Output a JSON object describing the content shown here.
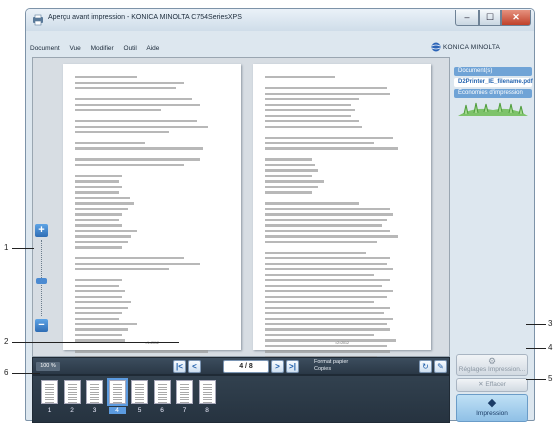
{
  "window": {
    "title": "Aperçu avant impression - KONICA MINOLTA C754SeriesXPS",
    "min": "–",
    "max": "☐",
    "close": "✕"
  },
  "menu": [
    {
      "label": "Document"
    },
    {
      "label": "Vue"
    },
    {
      "label": "Modifier"
    },
    {
      "label": "Outil"
    },
    {
      "label": "Aide"
    }
  ],
  "brand": {
    "name": "KONICA MINOLTA"
  },
  "side_panel": {
    "documents_label": "Document(s)",
    "file_name": "D2Printer_IE_filename.pdf",
    "eco_label": "Économies d'impression"
  },
  "page_footer": [
    "=1=2012",
    "=2=2012"
  ],
  "toolbar": {
    "zoom_value": "100 %",
    "page_indicator": "4 / 8",
    "format_label": "Format papier",
    "copies_label": "Copies"
  },
  "thumbnails": [
    "1",
    "2",
    "3",
    "4",
    "5",
    "6",
    "7",
    "8"
  ],
  "selected_thumbnail": 3,
  "actions": {
    "settings": "Réglages Impression...",
    "delete": "Effacer",
    "print": "Impression"
  },
  "callouts": {
    "c1": "1",
    "c2": "2",
    "c3": "3",
    "c4": "4",
    "c5": "5",
    "c6": "6"
  }
}
